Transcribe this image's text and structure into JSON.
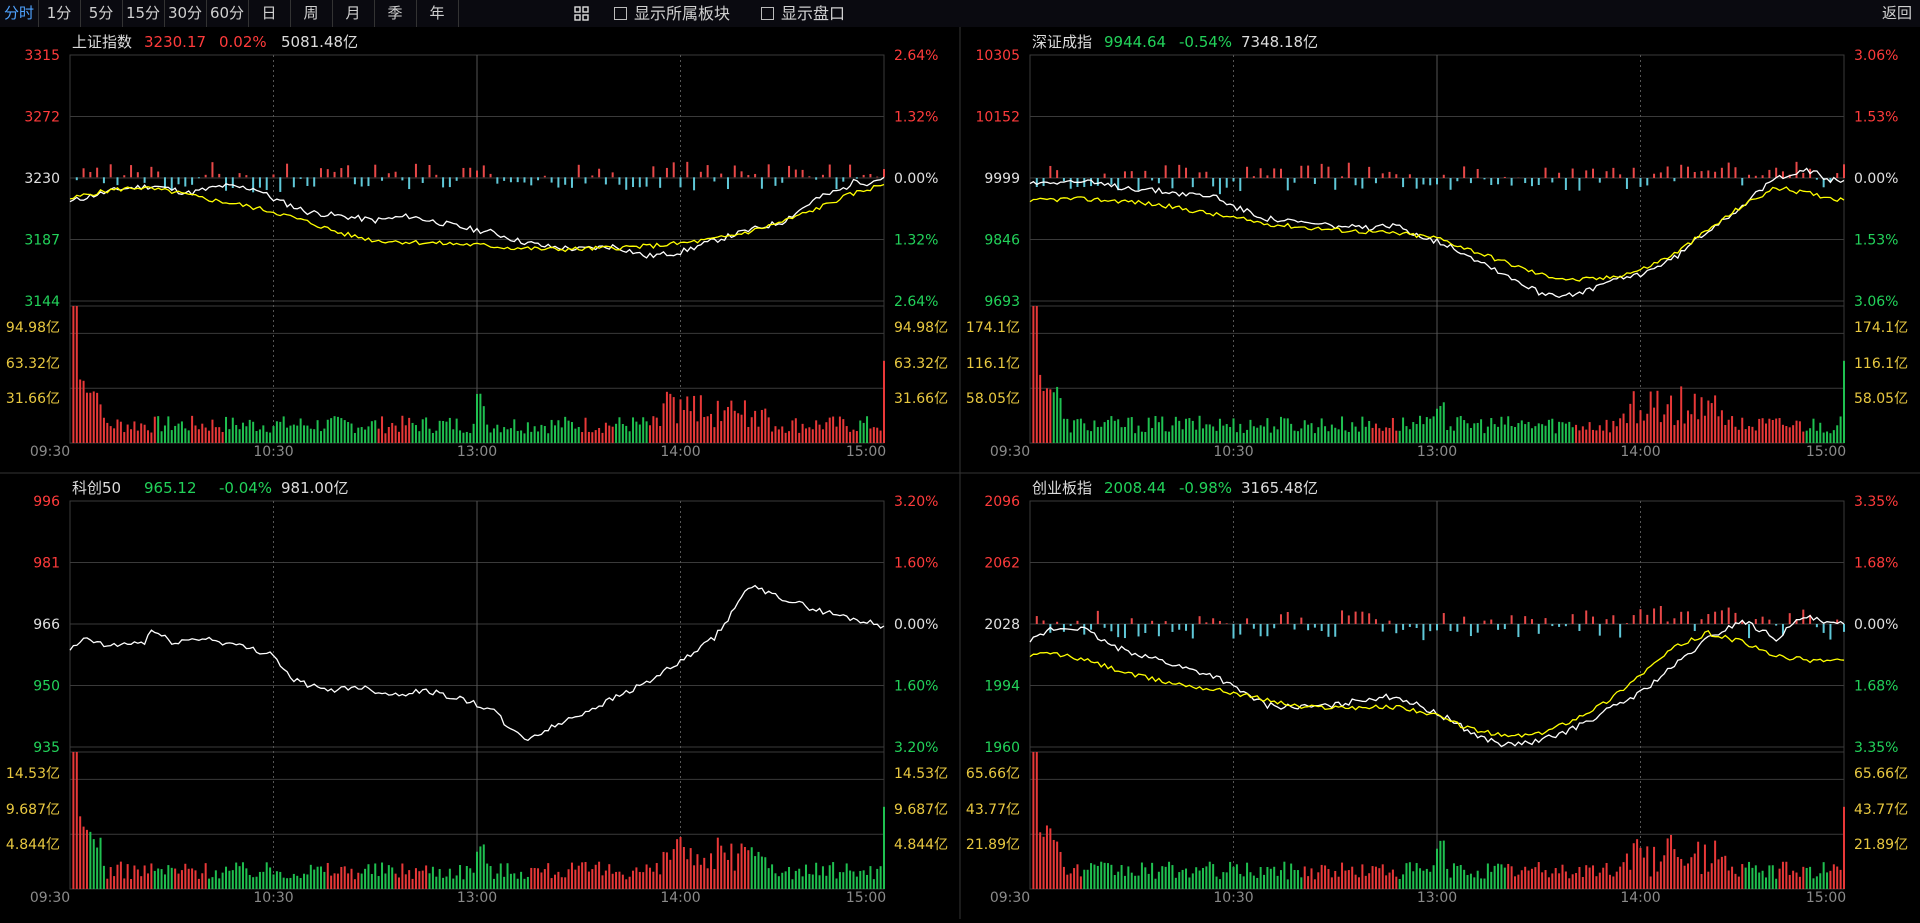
{
  "toolbar": {
    "periods": [
      "分时",
      "1分",
      "5分",
      "15分",
      "30分",
      "60分",
      "日",
      "周",
      "月",
      "季",
      "年"
    ],
    "active_index": 0,
    "grid_icon": "grid-icon",
    "check_sector": "显示所属板块",
    "check_book": "显示盘口",
    "back_label": "返回"
  },
  "colors": {
    "up": "#ff3b3b",
    "down": "#22d25a",
    "neutral": "#e0e0e0",
    "price_line": "#ffffff",
    "avg_line": "#ffff00",
    "vol_label": "#e8c840",
    "grid": "#3a3a3a",
    "bar_up": "#e84848",
    "bar_down": "#5fc8d8"
  },
  "chart_data": [
    {
      "type": "line",
      "panel": "top-left",
      "index_name": "上证指数",
      "price": "3230.17",
      "change_pct": "0.02%",
      "amount": "5081.48亿",
      "trend": "up",
      "y_labels": [
        "3315",
        "3272",
        "3230",
        "3187",
        "3144"
      ],
      "pct_labels": [
        "2.64%",
        "1.32%",
        "0.00%",
        "1.32%",
        "2.64%"
      ],
      "vol_labels": [
        "94.98亿",
        "63.32亿",
        "31.66亿"
      ],
      "time_labels": [
        "09:30",
        "10:30",
        "13:00",
        "14:00",
        "15:00"
      ],
      "ylim": [
        3144,
        3315
      ],
      "prev_close": 3230,
      "price_keys": [
        [
          0,
          3213
        ],
        [
          6,
          3217
        ],
        [
          15,
          3222
        ],
        [
          25,
          3224
        ],
        [
          35,
          3219
        ],
        [
          45,
          3224
        ],
        [
          55,
          3222
        ],
        [
          60,
          3215
        ],
        [
          70,
          3206
        ],
        [
          80,
          3203
        ],
        [
          90,
          3200
        ],
        [
          100,
          3203
        ],
        [
          108,
          3199
        ],
        [
          118,
          3194
        ],
        [
          124,
          3192
        ],
        [
          132,
          3186
        ],
        [
          140,
          3182
        ],
        [
          150,
          3180
        ],
        [
          160,
          3182
        ],
        [
          165,
          3179
        ],
        [
          170,
          3175
        ],
        [
          180,
          3178
        ],
        [
          190,
          3186
        ],
        [
          200,
          3193
        ],
        [
          210,
          3199
        ],
        [
          220,
          3215
        ],
        [
          228,
          3222
        ],
        [
          232,
          3228
        ],
        [
          235,
          3226
        ],
        [
          240,
          3230
        ]
      ],
      "avg_keys": [
        [
          0,
          3215
        ],
        [
          5,
          3218
        ],
        [
          12,
          3221
        ],
        [
          20,
          3223
        ],
        [
          30,
          3220
        ],
        [
          40,
          3215
        ],
        [
          50,
          3211
        ],
        [
          60,
          3206
        ],
        [
          70,
          3199
        ],
        [
          80,
          3191
        ],
        [
          90,
          3186
        ],
        [
          100,
          3185
        ],
        [
          110,
          3184
        ],
        [
          120,
          3183
        ],
        [
          130,
          3181
        ],
        [
          140,
          3180
        ],
        [
          150,
          3180
        ],
        [
          160,
          3181
        ],
        [
          170,
          3182
        ],
        [
          180,
          3184
        ],
        [
          190,
          3187
        ],
        [
          200,
          3192
        ],
        [
          210,
          3199
        ],
        [
          220,
          3208
        ],
        [
          230,
          3218
        ],
        [
          240,
          3225
        ]
      ],
      "has_avg": true,
      "has_breadth": true
    },
    {
      "type": "line",
      "panel": "top-right",
      "index_name": "深证成指",
      "price": "9944.64",
      "change_pct": "-0.54%",
      "amount": "7348.18亿",
      "trend": "down",
      "y_labels": [
        "10305",
        "10152",
        "9999",
        "9846",
        "9693"
      ],
      "pct_labels": [
        "3.06%",
        "1.53%",
        "0.00%",
        "1.53%",
        "3.06%"
      ],
      "vol_labels": [
        "174.1亿",
        "116.1亿",
        "58.05亿"
      ],
      "time_labels": [
        "09:30",
        "10:30",
        "13:00",
        "14:00",
        "15:00"
      ],
      "ylim": [
        9693,
        10305
      ],
      "prev_close": 9999,
      "price_keys": [
        [
          0,
          9985
        ],
        [
          6,
          9991
        ],
        [
          15,
          9990
        ],
        [
          25,
          9978
        ],
        [
          35,
          9970
        ],
        [
          45,
          9960
        ],
        [
          55,
          9953
        ],
        [
          60,
          9928
        ],
        [
          70,
          9898
        ],
        [
          80,
          9888
        ],
        [
          90,
          9880
        ],
        [
          100,
          9873
        ],
        [
          108,
          9880
        ],
        [
          118,
          9847
        ],
        [
          124,
          9830
        ],
        [
          132,
          9795
        ],
        [
          140,
          9760
        ],
        [
          150,
          9715
        ],
        [
          160,
          9705
        ],
        [
          165,
          9720
        ],
        [
          170,
          9740
        ],
        [
          180,
          9760
        ],
        [
          190,
          9800
        ],
        [
          200,
          9870
        ],
        [
          210,
          9930
        ],
        [
          220,
          10000
        ],
        [
          228,
          10020
        ],
        [
          232,
          10010
        ],
        [
          235,
          9995
        ],
        [
          240,
          9993
        ]
      ],
      "avg_keys": [
        [
          0,
          9940
        ],
        [
          5,
          9945
        ],
        [
          12,
          9947
        ],
        [
          20,
          9945
        ],
        [
          30,
          9940
        ],
        [
          40,
          9930
        ],
        [
          50,
          9915
        ],
        [
          60,
          9900
        ],
        [
          70,
          9885
        ],
        [
          80,
          9877
        ],
        [
          90,
          9870
        ],
        [
          100,
          9865
        ],
        [
          110,
          9860
        ],
        [
          120,
          9850
        ],
        [
          130,
          9820
        ],
        [
          140,
          9790
        ],
        [
          150,
          9760
        ],
        [
          160,
          9745
        ],
        [
          170,
          9750
        ],
        [
          180,
          9770
        ],
        [
          190,
          9810
        ],
        [
          200,
          9870
        ],
        [
          210,
          9930
        ],
        [
          220,
          9975
        ],
        [
          230,
          9960
        ],
        [
          240,
          9944
        ]
      ],
      "has_avg": true,
      "has_breadth": true
    },
    {
      "type": "line",
      "panel": "bottom-left",
      "index_name": "科创50",
      "price": "965.12",
      "change_pct": "-0.04%",
      "amount": "981.00亿",
      "trend": "down",
      "y_labels": [
        "996",
        "981",
        "966",
        "950",
        "935"
      ],
      "pct_labels": [
        "3.20%",
        "1.60%",
        "0.00%",
        "1.60%",
        "3.20%"
      ],
      "vol_labels": [
        "14.53亿",
        "9.687亿",
        "4.844亿"
      ],
      "time_labels": [
        "09:30",
        "10:30",
        "13:00",
        "14:00",
        "15:00"
      ],
      "ylim": [
        935,
        996
      ],
      "prev_close": 966,
      "price_keys": [
        [
          0,
          959
        ],
        [
          5,
          962
        ],
        [
          10,
          960
        ],
        [
          22,
          961
        ],
        [
          24,
          964
        ],
        [
          30,
          961
        ],
        [
          40,
          962
        ],
        [
          50,
          960
        ],
        [
          60,
          958
        ],
        [
          65,
          952
        ],
        [
          75,
          949
        ],
        [
          85,
          950
        ],
        [
          95,
          948
        ],
        [
          105,
          949
        ],
        [
          115,
          947
        ],
        [
          125,
          944
        ],
        [
          130,
          939
        ],
        [
          135,
          937
        ],
        [
          140,
          939
        ],
        [
          150,
          943
        ],
        [
          160,
          947
        ],
        [
          170,
          951
        ],
        [
          180,
          956
        ],
        [
          190,
          962
        ],
        [
          195,
          968
        ],
        [
          200,
          975
        ],
        [
          206,
          973
        ],
        [
          210,
          972
        ],
        [
          220,
          969
        ],
        [
          230,
          967
        ],
        [
          240,
          965
        ]
      ],
      "has_avg": false,
      "has_breadth": false
    },
    {
      "type": "line",
      "panel": "bottom-right",
      "index_name": "创业板指",
      "price": "2008.44",
      "change_pct": "-0.98%",
      "amount": "3165.48亿",
      "trend": "down",
      "y_labels": [
        "2096",
        "2062",
        "2028",
        "1994",
        "1960"
      ],
      "pct_labels": [
        "3.35%",
        "1.68%",
        "0.00%",
        "1.68%",
        "3.35%"
      ],
      "vol_labels": [
        "65.66亿",
        "43.77亿",
        "21.89亿"
      ],
      "time_labels": [
        "09:30",
        "10:30",
        "13:00",
        "14:00",
        "15:00"
      ],
      "ylim": [
        1960,
        2096
      ],
      "prev_close": 2028,
      "price_keys": [
        [
          0,
          2018
        ],
        [
          6,
          2025
        ],
        [
          15,
          2026
        ],
        [
          25,
          2015
        ],
        [
          35,
          2010
        ],
        [
          45,
          2004
        ],
        [
          55,
          1999
        ],
        [
          60,
          1993
        ],
        [
          70,
          1983
        ],
        [
          80,
          1982
        ],
        [
          90,
          1983
        ],
        [
          100,
          1987
        ],
        [
          108,
          1988
        ],
        [
          118,
          1980
        ],
        [
          124,
          1975
        ],
        [
          132,
          1966
        ],
        [
          140,
          1961
        ],
        [
          150,
          1963
        ],
        [
          160,
          1970
        ],
        [
          170,
          1980
        ],
        [
          180,
          1990
        ],
        [
          190,
          2005
        ],
        [
          200,
          2020
        ],
        [
          210,
          2030
        ],
        [
          220,
          2020
        ],
        [
          228,
          2032
        ],
        [
          232,
          2030
        ],
        [
          235,
          2028
        ],
        [
          240,
          2028
        ]
      ],
      "avg_keys": [
        [
          0,
          2010
        ],
        [
          5,
          2012
        ],
        [
          12,
          2010
        ],
        [
          20,
          2006
        ],
        [
          30,
          2000
        ],
        [
          40,
          1996
        ],
        [
          50,
          1993
        ],
        [
          60,
          1990
        ],
        [
          70,
          1986
        ],
        [
          80,
          1982
        ],
        [
          90,
          1982
        ],
        [
          100,
          1982
        ],
        [
          110,
          1982
        ],
        [
          120,
          1977
        ],
        [
          130,
          1970
        ],
        [
          140,
          1966
        ],
        [
          150,
          1967
        ],
        [
          160,
          1975
        ],
        [
          170,
          1985
        ],
        [
          180,
          2000
        ],
        [
          190,
          2015
        ],
        [
          200,
          2023
        ],
        [
          210,
          2018
        ],
        [
          220,
          2010
        ],
        [
          230,
          2008
        ],
        [
          240,
          2008
        ]
      ],
      "has_avg": true,
      "has_breadth": true
    }
  ]
}
